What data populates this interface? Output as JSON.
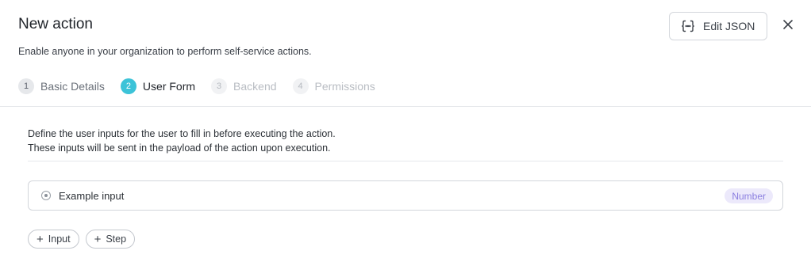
{
  "dialog": {
    "title": "New action",
    "subtitle": "Enable anyone in your organization to perform self-service actions.",
    "edit_json_label": "Edit JSON",
    "close_icon": "close-icon"
  },
  "steps": [
    {
      "number": "1",
      "label": "Basic Details",
      "state": "done"
    },
    {
      "number": "2",
      "label": "User Form",
      "state": "active"
    },
    {
      "number": "3",
      "label": "Backend",
      "state": "todo"
    },
    {
      "number": "4",
      "label": "Permissions",
      "state": "todo"
    }
  ],
  "user_form": {
    "description_line1": "Define the user inputs for the user to fill in before executing the action.",
    "description_line2": "These inputs will be sent in the payload of the action upon execution.",
    "inputs": [
      {
        "name": "Example input",
        "type": "Number"
      }
    ],
    "add_input_label": "Input",
    "add_step_label": "Step"
  },
  "colors": {
    "accent": "#3cc3d8",
    "badge_bg": "#ece9fb",
    "badge_text": "#8b7fe0"
  }
}
